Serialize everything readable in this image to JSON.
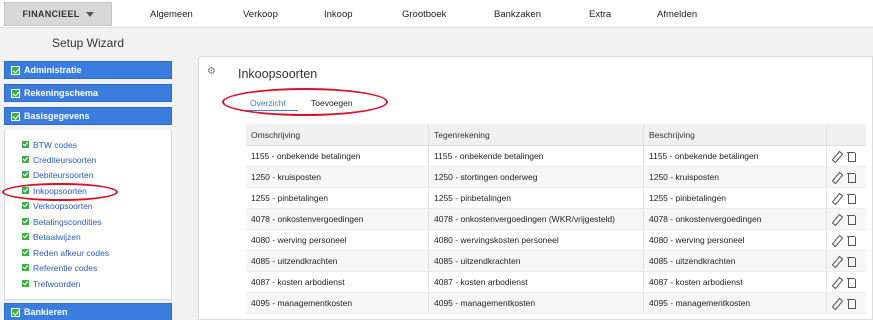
{
  "topbar": {
    "financieel_label": "FINANCIEEL",
    "nav": [
      "Algemeen",
      "Verkoop",
      "Inkoop",
      "Grootboek",
      "Bankzaken",
      "Extra",
      "Afmelden"
    ]
  },
  "sidebar": {
    "title": "Setup Wizard",
    "sections": {
      "administratie": "Administratie",
      "rekeningschema": "Rekeningschema",
      "basisgegevens": "Basisgegevens",
      "bankieren": "Bankieren"
    },
    "items": [
      "BTW codes",
      "Crediteursoorten",
      "Debiteursoorten",
      "Inkoopsoorten",
      "Verkoopsoorten",
      "Betalingscondities",
      "Betaalwijzen",
      "Reden afkeur codes",
      "Referentie codes",
      "Trefwoorden"
    ]
  },
  "main": {
    "title": "Inkoopsoorten",
    "tabs": [
      "Overzicht",
      "Toevoegen"
    ],
    "columns": [
      "Omschrijving",
      "Tegenrekening",
      "Beschrijving"
    ],
    "rows": [
      [
        "1155 - onbekende betalingen",
        "1155 - onbekende betalingen",
        "1155 - onbekende betalingen"
      ],
      [
        "1250 - kruisposten",
        "1250 - stortingen onderweg",
        "1250 - kruisposten"
      ],
      [
        "1255 - pinbetalingen",
        "1255 - pinbetalingen",
        "1255 - pinbetalingen"
      ],
      [
        "4078 - onkostenvergoedingen",
        "4078 - onkostenvergoedingen (WKR/vrijgesteld)",
        "4078 - onkostenvergoedingen"
      ],
      [
        "4080 - werving personeel",
        "4080 - wervingskosten personeel",
        "4080 - werving personeel"
      ],
      [
        "4085 - uitzendkrachten",
        "4085 - uitzendkrachten",
        "4085 - uitzendkrachten"
      ],
      [
        "4087 - kosten arbodienst",
        "4087 - kosten arbodienst",
        "4087 - kosten arbodienst"
      ],
      [
        "4095 - managementkosten",
        "4095 - managementkosten",
        "4095 - managementkosten"
      ]
    ]
  },
  "colors": {
    "accent": "#3a7dde",
    "check": "#3fae49",
    "annotation": "#d9112a"
  }
}
